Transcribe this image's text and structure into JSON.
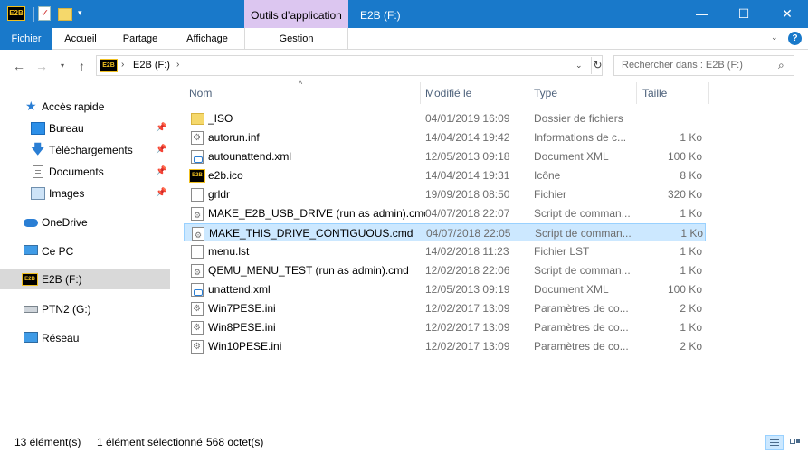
{
  "window": {
    "title": "E2B (F:)",
    "tools_tab": "Outils d’application",
    "app_logo_text": "E2B",
    "buttons": {
      "minimize": "—",
      "maximize": "☐",
      "close": "✕"
    }
  },
  "quick_access_toolbar": {
    "dropdown_glyph": "▾"
  },
  "ribbon": {
    "tabs": [
      {
        "label": "Fichier"
      },
      {
        "label": "Accueil"
      },
      {
        "label": "Partage"
      },
      {
        "label": "Affichage"
      },
      {
        "label": "Gestion"
      }
    ],
    "expand_glyph": "⌄",
    "help_glyph": "?"
  },
  "navigation": {
    "back_glyph": "←",
    "forward_glyph": "→",
    "recent_glyph": "▾",
    "up_glyph": "↑"
  },
  "address_bar": {
    "logo_text": "E2B",
    "chevron": "›",
    "crumb": "E2B (F:)",
    "dropdown_glyph": "⌄",
    "refresh_glyph": "↻"
  },
  "search": {
    "placeholder": "Rechercher dans : E2B (F:)",
    "icon_glyph": "⌕"
  },
  "sidebar": {
    "items": [
      {
        "label": "Accès rapide",
        "icon": "star-icon"
      },
      {
        "label": "Bureau",
        "icon": "desktop-icon",
        "pinned": true
      },
      {
        "label": "Téléchargements",
        "icon": "download-icon",
        "pinned": true
      },
      {
        "label": "Documents",
        "icon": "documents-icon",
        "pinned": true
      },
      {
        "label": "Images",
        "icon": "pictures-icon",
        "pinned": true
      },
      {
        "label": "OneDrive",
        "icon": "onedrive-icon"
      },
      {
        "label": "Ce PC",
        "icon": "pc-icon"
      },
      {
        "label": "E2B (F:)",
        "icon": "e2b-drive-icon",
        "selected": true
      },
      {
        "label": "PTN2 (G:)",
        "icon": "usb-drive-icon"
      },
      {
        "label": "Réseau",
        "icon": "network-icon"
      }
    ],
    "pin_glyph": "📌",
    "star_glyph": "★",
    "download_glyph": "🡇",
    "drive_logo_text": "E2B"
  },
  "file_list": {
    "columns": {
      "name": "Nom",
      "modified": "Modifié le",
      "type": "Type",
      "size": "Taille"
    },
    "sort_glyph": "^",
    "rows": [
      {
        "name": "_ISO",
        "date": "04/01/2019 16:09",
        "type": "Dossier de fichiers",
        "size": "",
        "icon": "folder-icon"
      },
      {
        "name": "autorun.inf",
        "date": "14/04/2014 19:42",
        "type": "Informations de c...",
        "size": "1 Ko",
        "icon": "settings-file-icon"
      },
      {
        "name": "autounattend.xml",
        "date": "12/05/2013 09:18",
        "type": "Document XML",
        "size": "100 Ko",
        "icon": "xml-file-icon"
      },
      {
        "name": "e2b.ico",
        "date": "14/04/2014 19:31",
        "type": "Icône",
        "size": "8 Ko",
        "icon": "ico-file-icon"
      },
      {
        "name": "grldr",
        "date": "19/09/2018 08:50",
        "type": "Fichier",
        "size": "320 Ko",
        "icon": "file-icon"
      },
      {
        "name": "MAKE_E2B_USB_DRIVE (run as admin).cmd",
        "date": "04/07/2018 22:07",
        "type": "Script de comman...",
        "size": "1 Ko",
        "icon": "cmd-file-icon"
      },
      {
        "name": "MAKE_THIS_DRIVE_CONTIGUOUS.cmd",
        "date": "04/07/2018 22:05",
        "type": "Script de comman...",
        "size": "1 Ko",
        "icon": "cmd-file-icon",
        "selected": true
      },
      {
        "name": "menu.lst",
        "date": "14/02/2018 11:23",
        "type": "Fichier LST",
        "size": "1 Ko",
        "icon": "file-icon"
      },
      {
        "name": "QEMU_MENU_TEST (run as admin).cmd",
        "date": "12/02/2018 22:06",
        "type": "Script de comman...",
        "size": "1 Ko",
        "icon": "cmd-file-icon"
      },
      {
        "name": "unattend.xml",
        "date": "12/05/2013 09:19",
        "type": "Document XML",
        "size": "100 Ko",
        "icon": "xml-file-icon"
      },
      {
        "name": "Win7PESE.ini",
        "date": "12/02/2017 13:09",
        "type": "Paramètres de co...",
        "size": "2 Ko",
        "icon": "settings-file-icon"
      },
      {
        "name": "Win8PESE.ini",
        "date": "12/02/2017 13:09",
        "type": "Paramètres de co...",
        "size": "1 Ko",
        "icon": "settings-file-icon"
      },
      {
        "name": "Win10PESE.ini",
        "date": "12/02/2017 13:09",
        "type": "Paramètres de co...",
        "size": "2 Ko",
        "icon": "settings-file-icon"
      }
    ]
  },
  "status_bar": {
    "count": "13 élément(s)",
    "selected": "1 élément sélectionné",
    "size": "568 octet(s)"
  }
}
